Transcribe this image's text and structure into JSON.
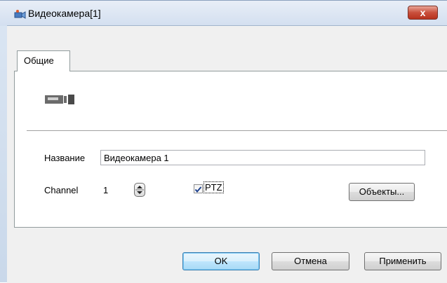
{
  "window": {
    "title": "Видеокамера[1]",
    "close_glyph": "x",
    "icon": "camera-app-icon"
  },
  "tabs": [
    {
      "label": "Общие",
      "selected": true
    }
  ],
  "panel": {
    "device_icon": "video-camera-icon",
    "name_label": "Название",
    "name_value": "Видеокамера 1",
    "channel_label": "Channel",
    "channel_value": "1",
    "ptz_label": "PTZ",
    "ptz_checked": true,
    "objects_button": "Объекты..."
  },
  "buttons": {
    "ok": "OK",
    "cancel": "Отмена",
    "apply": "Применить"
  },
  "colors": {
    "titlebar": "#d3dff0",
    "close_button": "#c9503c",
    "dialog_bg": "#f0f0f0",
    "default_button": "#bee6fd"
  }
}
